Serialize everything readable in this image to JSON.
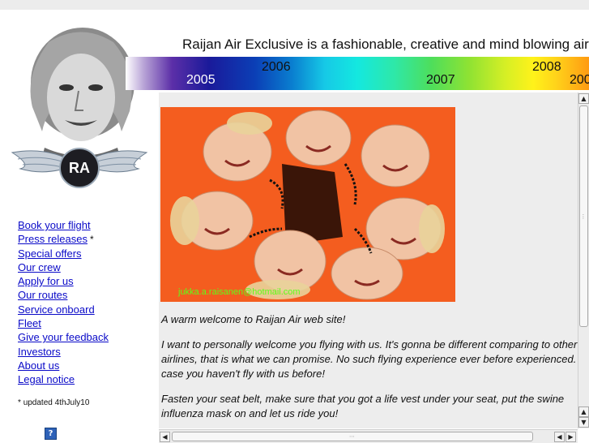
{
  "header": {
    "tagline": "Raijan Air Exclusive is a fashionable, creative and mind blowing airline",
    "timeline_years": [
      "2005",
      "2006",
      "2007",
      "2008",
      "200"
    ],
    "logo_text": "RA"
  },
  "nav": {
    "items": [
      {
        "label": "Book your flight",
        "starred": false
      },
      {
        "label": "Press releases",
        "starred": true
      },
      {
        "label": "Special offers",
        "starred": false
      },
      {
        "label": "Our crew",
        "starred": false
      },
      {
        "label": "Apply for us",
        "starred": false
      },
      {
        "label": "Our routes",
        "starred": false
      },
      {
        "label": "Service onboard",
        "starred": false
      },
      {
        "label": "Fleet",
        "starred": false
      },
      {
        "label": "Give your feedback",
        "starred": false
      },
      {
        "label": "Investors",
        "starred": false
      },
      {
        "label": "About us",
        "starred": false
      },
      {
        "label": "Legal notice",
        "starred": false
      }
    ],
    "star_symbol": "*",
    "footnote_star": "*",
    "footnote_text": "updated 4thJuly10",
    "help_label": "?"
  },
  "content": {
    "email_overlay": "jukka.a.raisanen@hotmail.com",
    "welcome": "A warm welcome to Raijan Air web site!",
    "paragraph1": "I want to personally welcome you flying with us. It's gonna be different comparing to other airlines, that is what we can promise. No such flying experience ever before experienced. case you haven't fly with us before!",
    "paragraph2": "Fasten your seat belt, make sure that you got a life vest under your seat, put the swine influenza mask on and let us ride you!"
  },
  "scrollbars": {
    "up_arrow": "▲",
    "down_arrow": "▼",
    "left_arrow": "◀",
    "right_arrow": "▶"
  },
  "colors": {
    "link": "#0a0ac8",
    "uniform_orange": "#f25a12",
    "overlay_green": "#5cff1a"
  }
}
